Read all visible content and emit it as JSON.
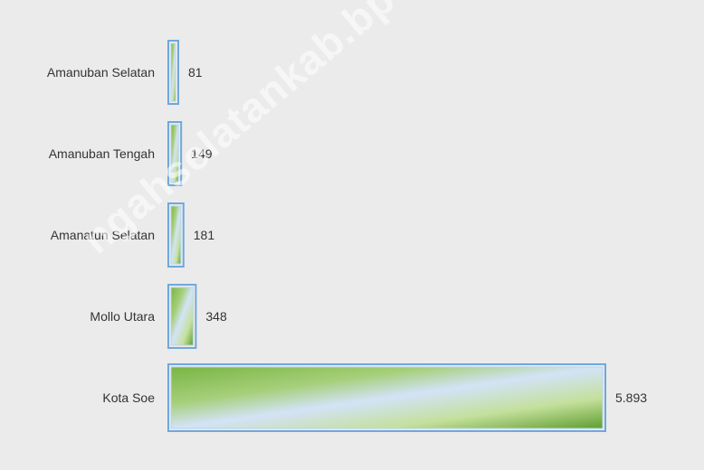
{
  "chart_data": {
    "type": "bar",
    "orientation": "horizontal",
    "categories": [
      "Amanuban Selatan",
      "Amanuban Tengah",
      "Amanatun Selatan",
      "Mollo Utara",
      "Kota Soe"
    ],
    "values": [
      81,
      149,
      181,
      348,
      5893
    ],
    "data_labels": [
      "81",
      "149",
      "181",
      "348",
      "5.893"
    ],
    "title": "",
    "xlabel": "",
    "ylabel": "",
    "xlim": [
      0,
      5893
    ],
    "grid": false,
    "legend": "none"
  },
  "watermark": "ngahselatankab.bps.go.id",
  "colors": {
    "background": "#ebebeb",
    "bar_green": "#6fae3c",
    "bar_light": "#cfe0f5",
    "bar_border": "#6fa8dc",
    "label_text": "#333333"
  }
}
